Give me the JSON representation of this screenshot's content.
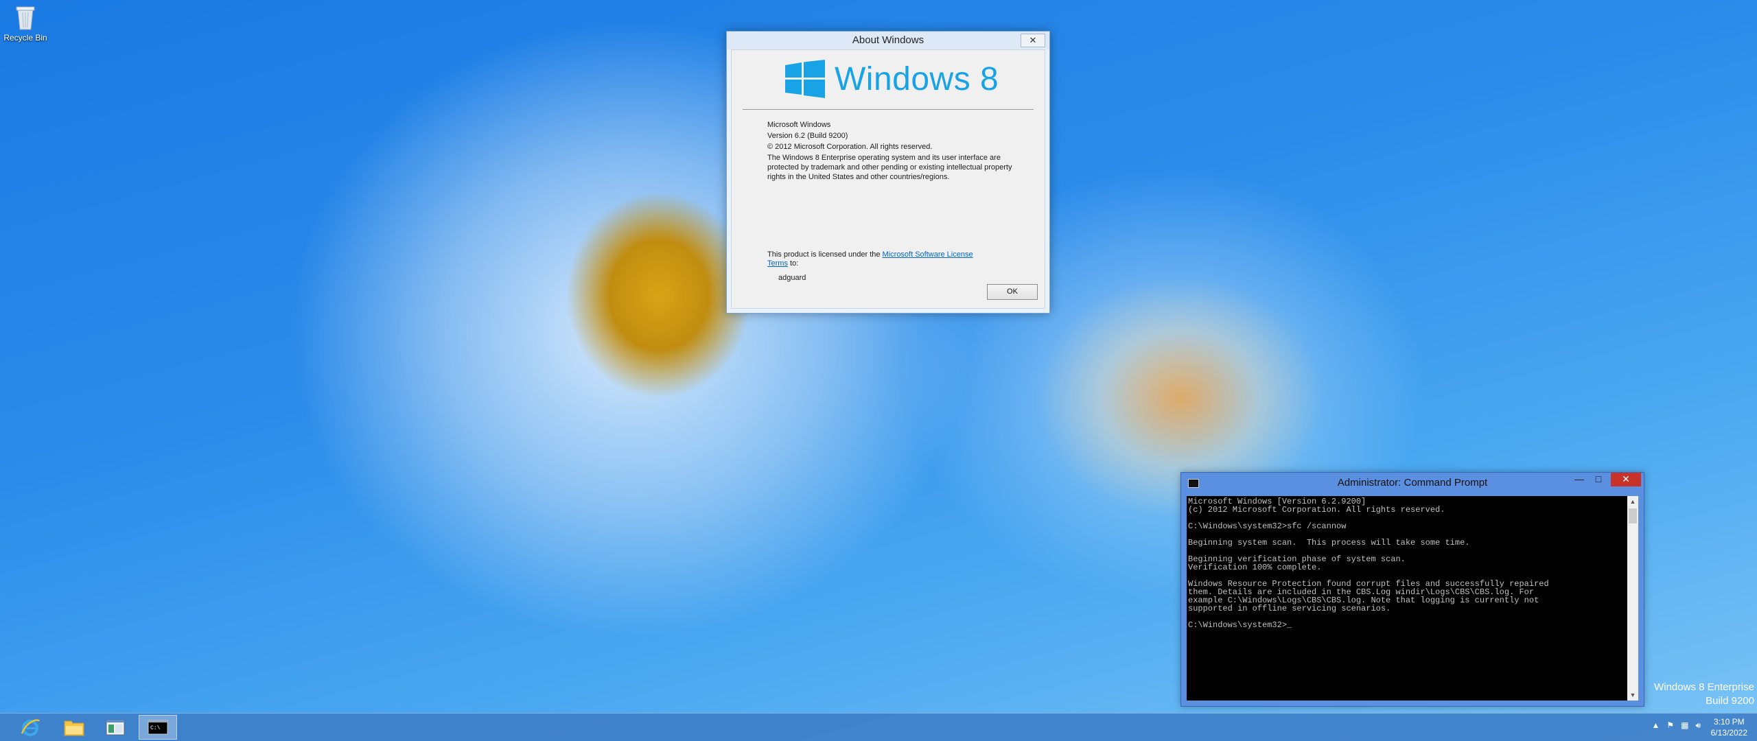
{
  "desktop": {
    "recycle_bin_label": "Recycle Bin"
  },
  "about_dialog": {
    "title": "About Windows",
    "close_label": "✕",
    "logo_text": "Windows 8",
    "info_lines": [
      "Microsoft Windows",
      "Version 6.2 (Build 9200)",
      "© 2012 Microsoft Corporation. All rights reserved.",
      "The Windows 8 Enterprise operating system and its user interface are protected by trademark and other pending or existing intellectual property rights in the United States and other countries/regions."
    ],
    "license_prefix": "This product is licensed under the",
    "license_link": "Microsoft Software License Terms",
    "license_suffix": "to:",
    "licensed_user": "adguard",
    "ok_label": "OK"
  },
  "cmd": {
    "title": "Administrator: Command Prompt",
    "min_label": "—",
    "max_label": "□",
    "close_label": "✕",
    "output": "Microsoft Windows [Version 6.2.9200]\n(c) 2012 Microsoft Corporation. All rights reserved.\n\nC:\\Windows\\system32>sfc /scannow\n\nBeginning system scan.  This process will take some time.\n\nBeginning verification phase of system scan.\nVerification 100% complete.\n\nWindows Resource Protection found corrupt files and successfully repaired\nthem. Details are included in the CBS.Log windir\\Logs\\CBS\\CBS.log. For\nexample C:\\Windows\\Logs\\CBS\\CBS.log. Note that logging is currently not\nsupported in offline servicing scenarios.\n\nC:\\Windows\\system32>_"
  },
  "watermark": {
    "edition": "Windows 8 Enterprise",
    "build": "Build 9200"
  },
  "taskbar": {
    "apps": [
      "internet-explorer",
      "file-explorer",
      "control-panel",
      "command-prompt"
    ],
    "time": "3:10 PM",
    "date": "6/13/2022"
  },
  "colors": {
    "accent": "#18a3e6",
    "taskbar": "#3e7ec8",
    "cmd_frame": "#5b8fe0",
    "close_red": "#c9312b"
  }
}
